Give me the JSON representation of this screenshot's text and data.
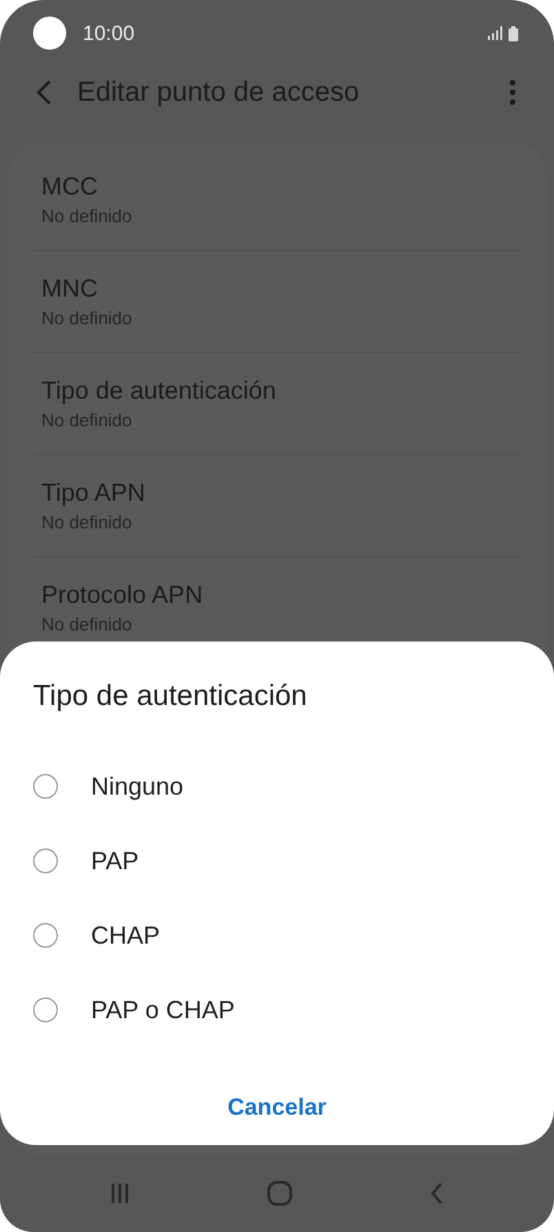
{
  "status_bar": {
    "time": "10:00"
  },
  "app_bar": {
    "title": "Editar punto de acceso"
  },
  "settings": [
    {
      "title": "MCC",
      "value": "No definido"
    },
    {
      "title": "MNC",
      "value": "No definido"
    },
    {
      "title": "Tipo de autenticación",
      "value": "No definido"
    },
    {
      "title": "Tipo APN",
      "value": "No definido"
    },
    {
      "title": "Protocolo APN",
      "value": "No definido"
    }
  ],
  "dialog": {
    "title": "Tipo de autenticación",
    "options": [
      {
        "label": "Ninguno",
        "selected": false
      },
      {
        "label": "PAP",
        "selected": false
      },
      {
        "label": "CHAP",
        "selected": false
      },
      {
        "label": "PAP o CHAP",
        "selected": false
      }
    ],
    "cancel": "Cancelar"
  }
}
